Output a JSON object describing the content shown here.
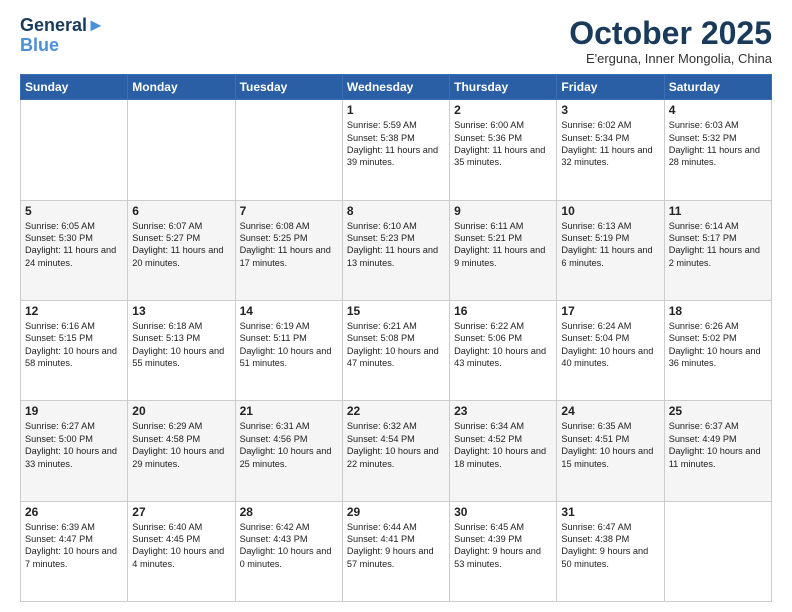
{
  "header": {
    "logo_line1": "General",
    "logo_line2": "Blue",
    "month": "October 2025",
    "location": "E'erguna, Inner Mongolia, China"
  },
  "days_of_week": [
    "Sunday",
    "Monday",
    "Tuesday",
    "Wednesday",
    "Thursday",
    "Friday",
    "Saturday"
  ],
  "weeks": [
    [
      {
        "day": "",
        "text": ""
      },
      {
        "day": "",
        "text": ""
      },
      {
        "day": "",
        "text": ""
      },
      {
        "day": "1",
        "text": "Sunrise: 5:59 AM\nSunset: 5:38 PM\nDaylight: 11 hours\nand 39 minutes."
      },
      {
        "day": "2",
        "text": "Sunrise: 6:00 AM\nSunset: 5:36 PM\nDaylight: 11 hours\nand 35 minutes."
      },
      {
        "day": "3",
        "text": "Sunrise: 6:02 AM\nSunset: 5:34 PM\nDaylight: 11 hours\nand 32 minutes."
      },
      {
        "day": "4",
        "text": "Sunrise: 6:03 AM\nSunset: 5:32 PM\nDaylight: 11 hours\nand 28 minutes."
      }
    ],
    [
      {
        "day": "5",
        "text": "Sunrise: 6:05 AM\nSunset: 5:30 PM\nDaylight: 11 hours\nand 24 minutes."
      },
      {
        "day": "6",
        "text": "Sunrise: 6:07 AM\nSunset: 5:27 PM\nDaylight: 11 hours\nand 20 minutes."
      },
      {
        "day": "7",
        "text": "Sunrise: 6:08 AM\nSunset: 5:25 PM\nDaylight: 11 hours\nand 17 minutes."
      },
      {
        "day": "8",
        "text": "Sunrise: 6:10 AM\nSunset: 5:23 PM\nDaylight: 11 hours\nand 13 minutes."
      },
      {
        "day": "9",
        "text": "Sunrise: 6:11 AM\nSunset: 5:21 PM\nDaylight: 11 hours\nand 9 minutes."
      },
      {
        "day": "10",
        "text": "Sunrise: 6:13 AM\nSunset: 5:19 PM\nDaylight: 11 hours\nand 6 minutes."
      },
      {
        "day": "11",
        "text": "Sunrise: 6:14 AM\nSunset: 5:17 PM\nDaylight: 11 hours\nand 2 minutes."
      }
    ],
    [
      {
        "day": "12",
        "text": "Sunrise: 6:16 AM\nSunset: 5:15 PM\nDaylight: 10 hours\nand 58 minutes."
      },
      {
        "day": "13",
        "text": "Sunrise: 6:18 AM\nSunset: 5:13 PM\nDaylight: 10 hours\nand 55 minutes."
      },
      {
        "day": "14",
        "text": "Sunrise: 6:19 AM\nSunset: 5:11 PM\nDaylight: 10 hours\nand 51 minutes."
      },
      {
        "day": "15",
        "text": "Sunrise: 6:21 AM\nSunset: 5:08 PM\nDaylight: 10 hours\nand 47 minutes."
      },
      {
        "day": "16",
        "text": "Sunrise: 6:22 AM\nSunset: 5:06 PM\nDaylight: 10 hours\nand 43 minutes."
      },
      {
        "day": "17",
        "text": "Sunrise: 6:24 AM\nSunset: 5:04 PM\nDaylight: 10 hours\nand 40 minutes."
      },
      {
        "day": "18",
        "text": "Sunrise: 6:26 AM\nSunset: 5:02 PM\nDaylight: 10 hours\nand 36 minutes."
      }
    ],
    [
      {
        "day": "19",
        "text": "Sunrise: 6:27 AM\nSunset: 5:00 PM\nDaylight: 10 hours\nand 33 minutes."
      },
      {
        "day": "20",
        "text": "Sunrise: 6:29 AM\nSunset: 4:58 PM\nDaylight: 10 hours\nand 29 minutes."
      },
      {
        "day": "21",
        "text": "Sunrise: 6:31 AM\nSunset: 4:56 PM\nDaylight: 10 hours\nand 25 minutes."
      },
      {
        "day": "22",
        "text": "Sunrise: 6:32 AM\nSunset: 4:54 PM\nDaylight: 10 hours\nand 22 minutes."
      },
      {
        "day": "23",
        "text": "Sunrise: 6:34 AM\nSunset: 4:52 PM\nDaylight: 10 hours\nand 18 minutes."
      },
      {
        "day": "24",
        "text": "Sunrise: 6:35 AM\nSunset: 4:51 PM\nDaylight: 10 hours\nand 15 minutes."
      },
      {
        "day": "25",
        "text": "Sunrise: 6:37 AM\nSunset: 4:49 PM\nDaylight: 10 hours\nand 11 minutes."
      }
    ],
    [
      {
        "day": "26",
        "text": "Sunrise: 6:39 AM\nSunset: 4:47 PM\nDaylight: 10 hours\nand 7 minutes."
      },
      {
        "day": "27",
        "text": "Sunrise: 6:40 AM\nSunset: 4:45 PM\nDaylight: 10 hours\nand 4 minutes."
      },
      {
        "day": "28",
        "text": "Sunrise: 6:42 AM\nSunset: 4:43 PM\nDaylight: 10 hours\nand 0 minutes."
      },
      {
        "day": "29",
        "text": "Sunrise: 6:44 AM\nSunset: 4:41 PM\nDaylight: 9 hours\nand 57 minutes."
      },
      {
        "day": "30",
        "text": "Sunrise: 6:45 AM\nSunset: 4:39 PM\nDaylight: 9 hours\nand 53 minutes."
      },
      {
        "day": "31",
        "text": "Sunrise: 6:47 AM\nSunset: 4:38 PM\nDaylight: 9 hours\nand 50 minutes."
      },
      {
        "day": "",
        "text": ""
      }
    ]
  ]
}
